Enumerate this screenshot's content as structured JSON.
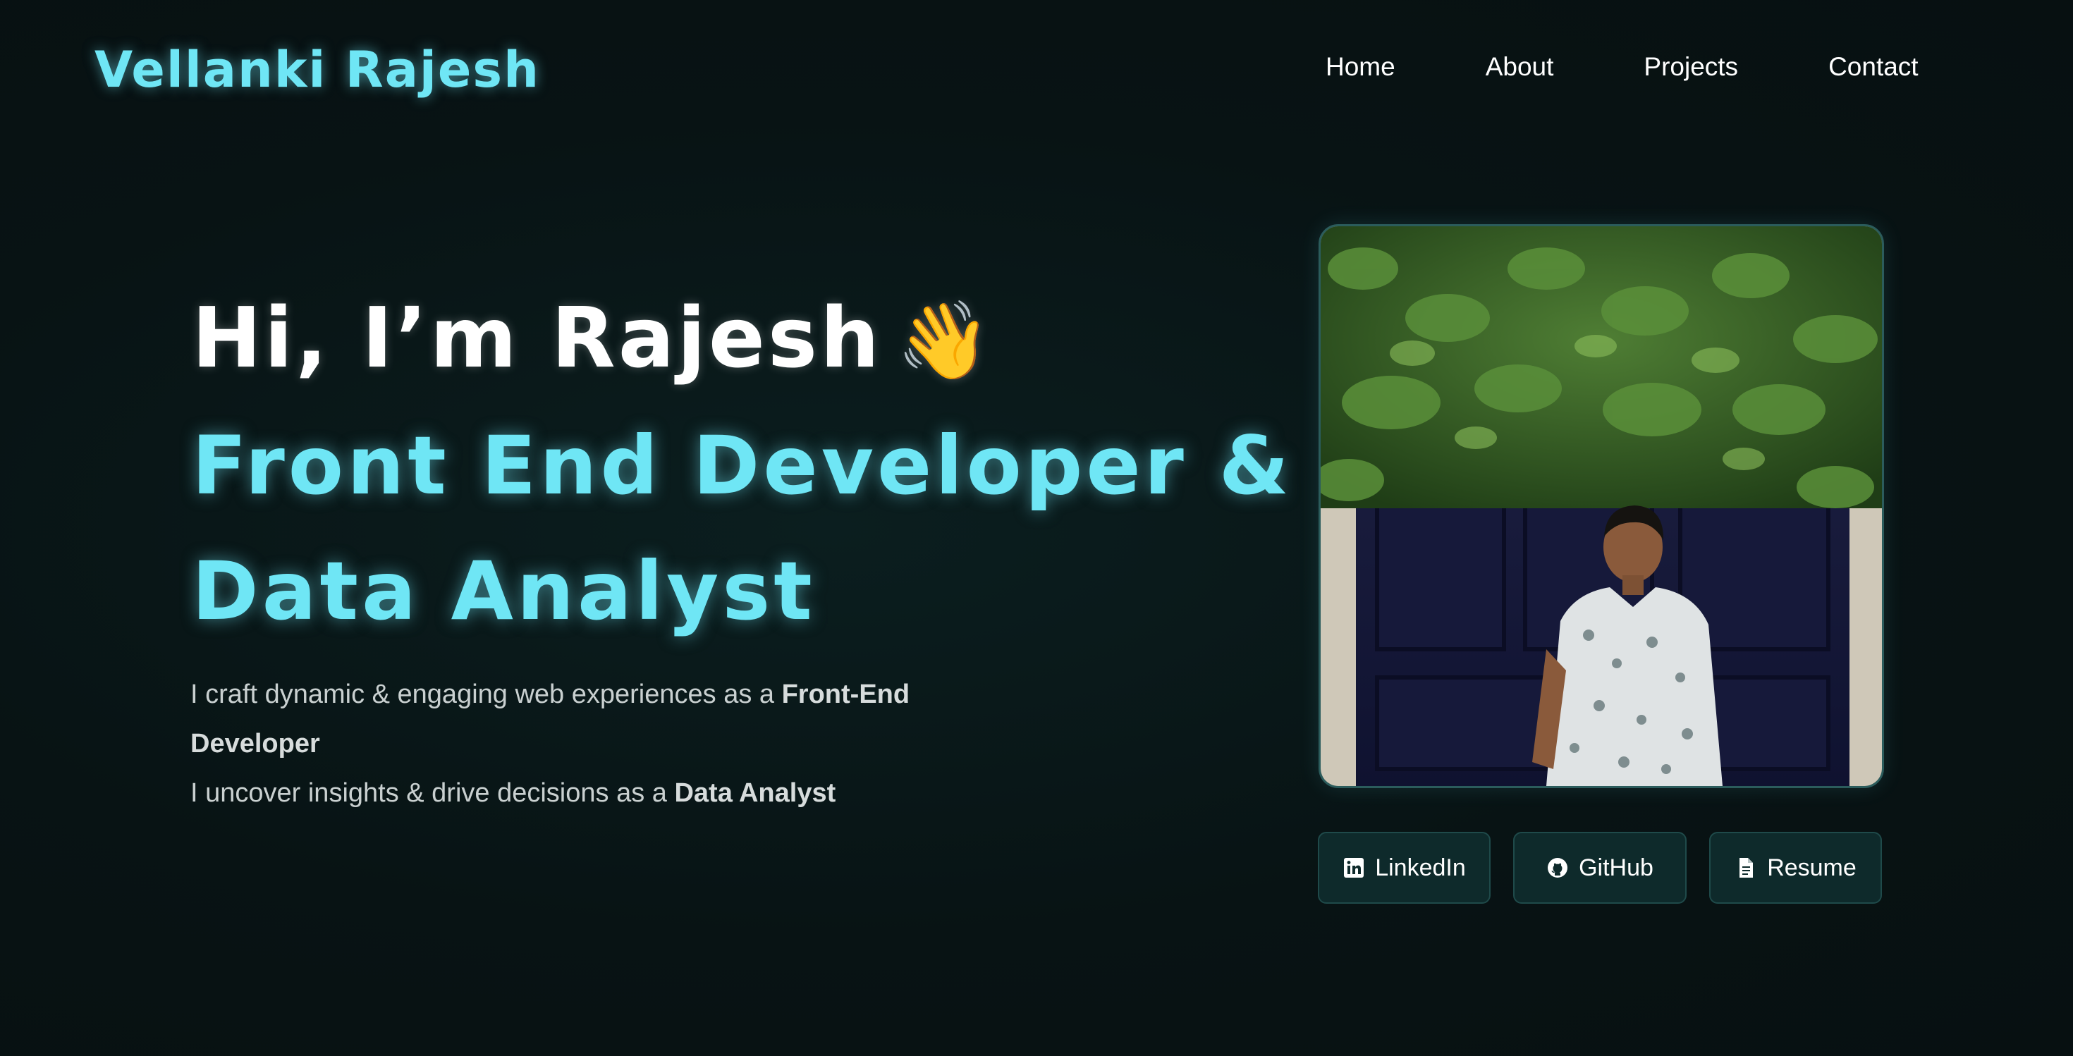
{
  "header": {
    "brand": "Vellanki Rajesh",
    "nav": [
      "Home",
      "About",
      "Projects",
      "Contact"
    ]
  },
  "hero": {
    "greeting": "Hi, I’m Rajesh",
    "wave_emoji": "👋",
    "role_line1": "Front End Developer &",
    "role_line2": "Data Analyst",
    "desc_line1_prefix": "I craft dynamic & engaging web experiences as a",
    "desc_line1_bold": "Front-End Developer",
    "desc_line2_prefix": "I uncover insights & drive decisions as a",
    "desc_line2_bold": "Data Analyst"
  },
  "profile": {
    "photo_alt": "Portrait of Rajesh standing in front of a navy door beneath green foliage"
  },
  "buttons": {
    "linkedin": "LinkedIn",
    "github": "GitHub",
    "resume": "Resume"
  },
  "colors": {
    "accent": "#6fe6f5",
    "background": "#081314",
    "button_bg": "#0e2a2b"
  },
  "icons": [
    "linkedin-icon",
    "github-icon",
    "document-icon",
    "waving-hand-icon"
  ]
}
